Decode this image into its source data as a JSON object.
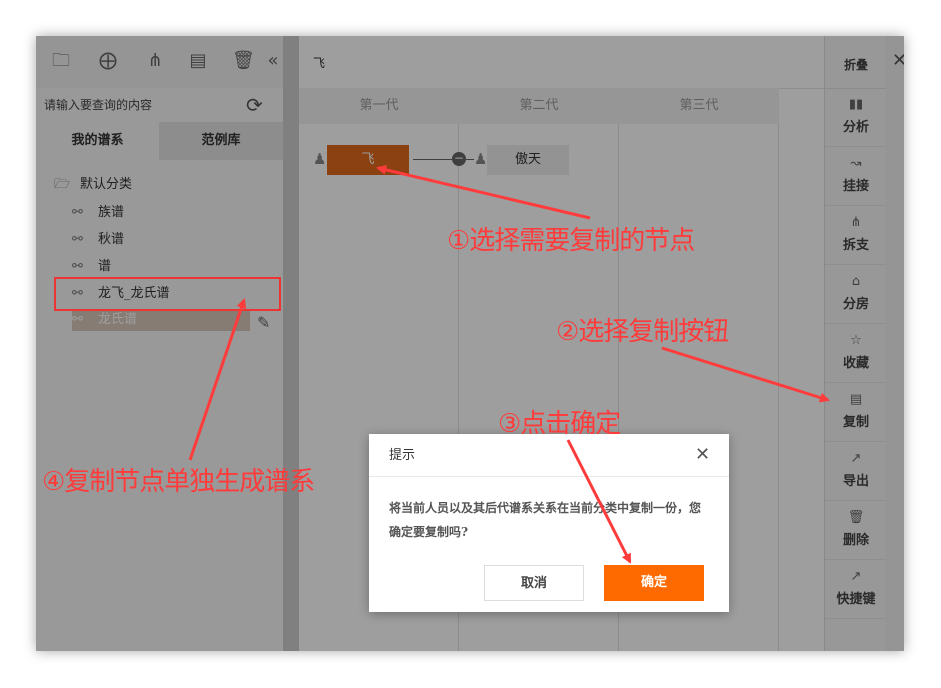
{
  "left_panel": {
    "search_placeholder": "请输入要查询的内容",
    "tabs": [
      "我的谱系",
      "范例库"
    ],
    "tree": {
      "root": "默认分类",
      "items": [
        "族谱",
        "秋谱",
        "谱",
        "龙飞_龙氏谱",
        "龙氏谱"
      ]
    }
  },
  "main": {
    "title": "飞",
    "generations": [
      "第一代",
      "第二代",
      "第三代"
    ],
    "nodes": {
      "selected": "飞",
      "child": "傲天"
    }
  },
  "right_sidebar": {
    "header": "折叠",
    "items": [
      {
        "icon": "chart-icon",
        "label": "分析"
      },
      {
        "icon": "link-icon",
        "label": "挂接"
      },
      {
        "icon": "branch-icon",
        "label": "拆支"
      },
      {
        "icon": "home-icon",
        "label": "分房"
      },
      {
        "icon": "star-icon",
        "label": "收藏"
      },
      {
        "icon": "copy-icon",
        "label": "复制"
      },
      {
        "icon": "export-icon",
        "label": "导出"
      },
      {
        "icon": "trash-icon",
        "label": "删除"
      },
      {
        "icon": "shortcut-icon",
        "label": "快捷键"
      }
    ]
  },
  "dialog": {
    "title": "提示",
    "message": "将当前人员以及其后代谱系关系在当前分类中复制一份，您确定要复制吗?",
    "cancel_label": "取消",
    "ok_label": "确定"
  },
  "annotations": {
    "step1": "①选择需要复制的节点",
    "step2": "②选择复制按钮",
    "step3": "③点击确定",
    "step4": "④复制节点单独生成谱系"
  },
  "colors": {
    "accent": "#ff6a00",
    "annotation": "#ff3b3b",
    "selected_node": "#e06a1c"
  }
}
